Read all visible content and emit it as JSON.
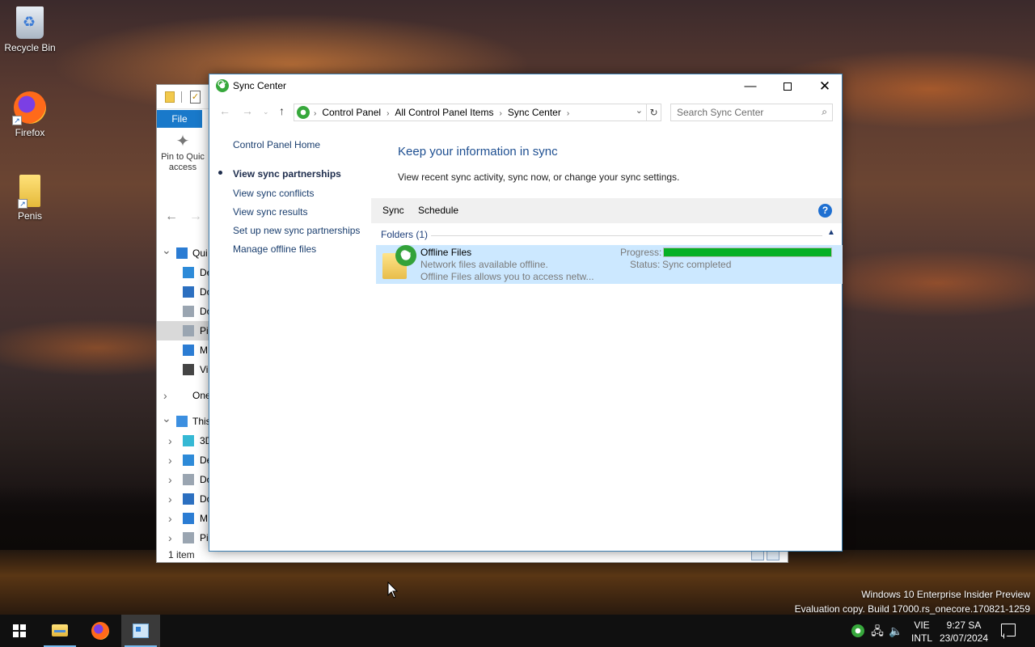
{
  "desktop": {
    "icons": [
      {
        "label": "Recycle Bin",
        "icon": "recycle-bin-icon"
      },
      {
        "label": "Firefox",
        "icon": "firefox-icon"
      },
      {
        "label": "Penis",
        "icon": "folder-icon"
      }
    ],
    "watermark": {
      "line1": "Windows 10 Enterprise Insider Preview",
      "line2": "Evaluation copy. Build 17000.rs_onecore.170821-1259"
    }
  },
  "explorer": {
    "file_tab": "File",
    "pin_label_line1": "Pin to Quic",
    "pin_label_line2": "access",
    "tree": [
      {
        "label": "Qui",
        "chevron": "v",
        "icon_color": "#2b7cd3",
        "sel": false
      },
      {
        "label": "De",
        "chevron": "",
        "icon_color": "#2d8ad8",
        "sel": false
      },
      {
        "label": "Do",
        "chevron": "",
        "icon_color": "#2b6fc0",
        "sel": false
      },
      {
        "label": "Do",
        "chevron": "",
        "icon_color": "#9aa5b1",
        "sel": false
      },
      {
        "label": "Pi",
        "chevron": "",
        "icon_color": "#9aa5b1",
        "sel": true
      },
      {
        "label": "M",
        "chevron": "",
        "icon_color": "#2b7cd3",
        "sel": false
      },
      {
        "label": "Vi",
        "chevron": "",
        "icon_color": "#444444",
        "sel": false
      },
      {
        "label": "One",
        "chevron": ">",
        "icon_color": "",
        "sel": false
      },
      {
        "label": "This",
        "chevron": "v",
        "icon_color": "#3c8fe0",
        "sel": false
      },
      {
        "label": "3D",
        "chevron": ">",
        "icon_color": "#35b8d4",
        "sel": false
      },
      {
        "label": "De",
        "chevron": ">",
        "icon_color": "#2d8ad8",
        "sel": false
      },
      {
        "label": "Do",
        "chevron": ">",
        "icon_color": "#9aa5b1",
        "sel": false
      },
      {
        "label": "Do",
        "chevron": ">",
        "icon_color": "#2b6fc0",
        "sel": false
      },
      {
        "label": "M",
        "chevron": ">",
        "icon_color": "#2b7cd3",
        "sel": false
      },
      {
        "label": "Pi",
        "chevron": ">",
        "icon_color": "#9aa5b1",
        "sel": false
      }
    ],
    "status": "1 item"
  },
  "sync_window": {
    "title": "Sync Center",
    "address": {
      "crumbs": [
        "Control Panel",
        "All Control Panel Items",
        "Sync Center"
      ]
    },
    "search_placeholder": "Search Sync Center",
    "left_nav": {
      "home": "Control Panel Home",
      "current": "View sync partnerships",
      "links": [
        "View sync conflicts",
        "View sync results",
        "Set up new sync partnerships",
        "Manage offline files"
      ]
    },
    "heading": "Keep your information in sync",
    "subtext": "View recent sync activity, sync now, or change your sync settings.",
    "commands": {
      "sync": "Sync",
      "schedule": "Schedule"
    },
    "group_header": "Folders (1)",
    "item": {
      "name": "Offline Files",
      "desc1": "Network files available offline.",
      "desc2": "Offline Files allows you to access netw...",
      "progress_label": "Progress:",
      "progress_value": 1.0,
      "status_label": "Status:",
      "status_value": "Sync completed"
    },
    "colors": {
      "progress": "#06b025",
      "selection": "#cce8ff",
      "heading": "#1e4f91"
    }
  },
  "taskbar": {
    "lang_line1": "VIE",
    "lang_line2": "INTL",
    "time": "9:27 SA",
    "date": "23/07/2024"
  }
}
